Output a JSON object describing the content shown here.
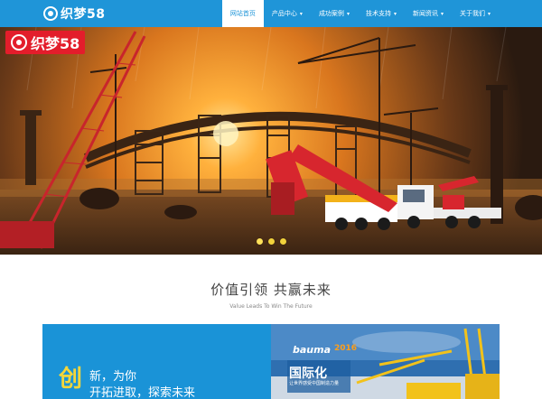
{
  "header": {
    "brand": "织梦58",
    "nav": [
      {
        "label": "网站首页",
        "active": true,
        "has_menu": false
      },
      {
        "label": "产品中心",
        "active": false,
        "has_menu": true
      },
      {
        "label": "成功案例",
        "active": false,
        "has_menu": true
      },
      {
        "label": "技术支持",
        "active": false,
        "has_menu": true
      },
      {
        "label": "新闻资讯",
        "active": false,
        "has_menu": true
      },
      {
        "label": "关于我们",
        "active": false,
        "has_menu": true
      }
    ],
    "caret": "▾"
  },
  "hero": {
    "badge": "织梦58",
    "slides": 3,
    "active_slide": 0
  },
  "section": {
    "title": "价值引领  共赢未来",
    "subtitle": "Value Leads To Win The Future"
  },
  "cards": {
    "left": {
      "big_char": "创",
      "line1": "新，为你",
      "line2": "开拓进取，探索未来"
    },
    "right": {
      "bauma": "bauma",
      "year": "2016",
      "headline": "国际化",
      "subline": "让世界感受中国制造力量"
    }
  },
  "colors": {
    "nav_bg": "#1f95d8",
    "badge_red": "#e31d2b",
    "card_blue": "#1a93d7",
    "accent_yellow": "#f4d63a"
  }
}
